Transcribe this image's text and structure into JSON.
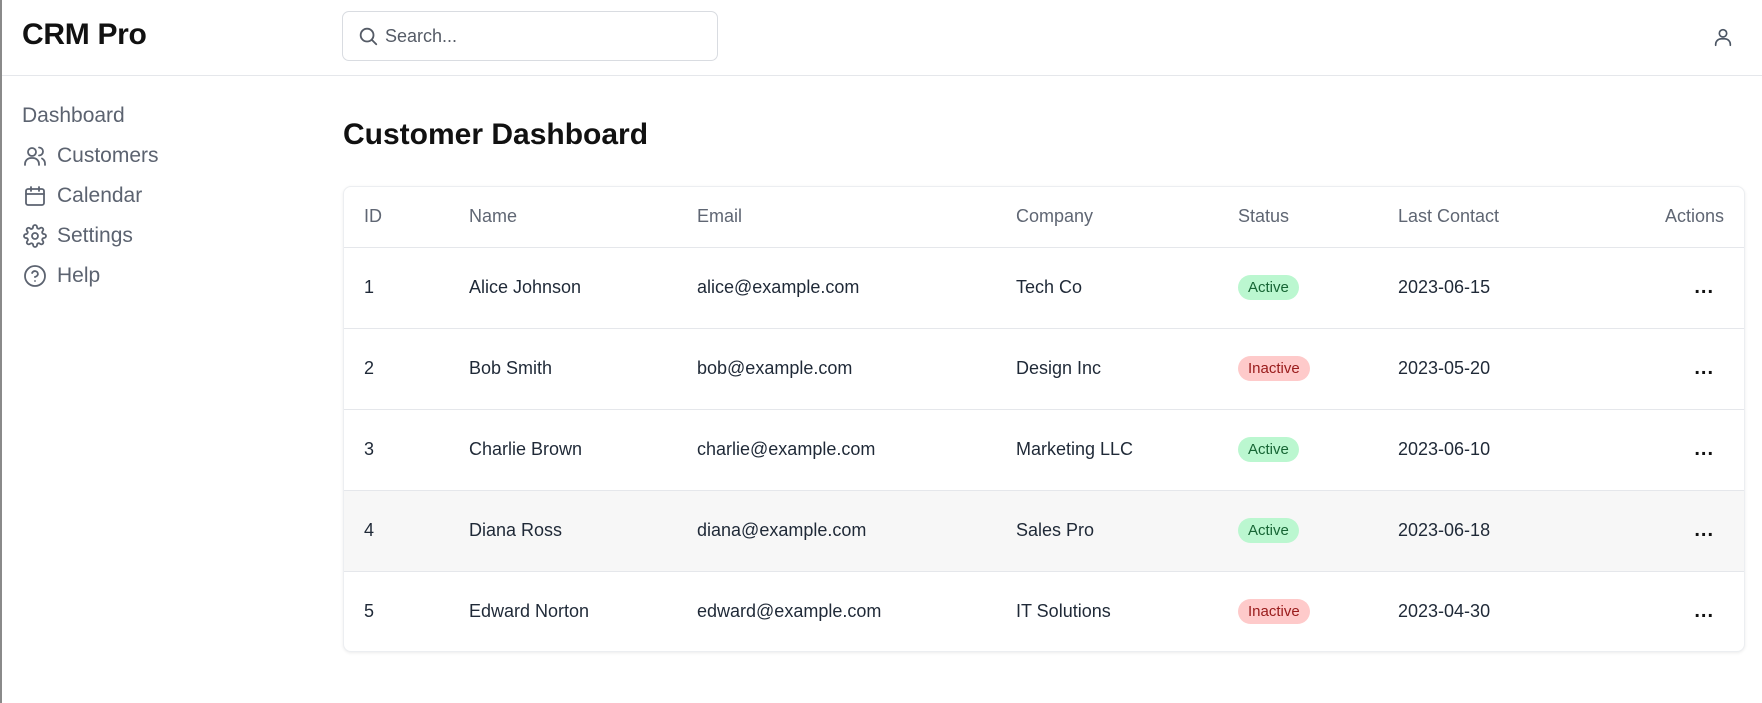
{
  "app": {
    "title": "CRM Pro"
  },
  "search": {
    "placeholder": "Search...",
    "value": ""
  },
  "sidebar": {
    "items": [
      {
        "label": "Dashboard",
        "icon": ""
      },
      {
        "label": "Customers",
        "icon": "users-icon"
      },
      {
        "label": "Calendar",
        "icon": "calendar-icon"
      },
      {
        "label": "Settings",
        "icon": "gear-icon"
      },
      {
        "label": "Help",
        "icon": "help-circle-icon"
      }
    ]
  },
  "main": {
    "title": "Customer Dashboard",
    "table": {
      "columns": [
        "ID",
        "Name",
        "Email",
        "Company",
        "Status",
        "Last Contact",
        "Actions"
      ],
      "rows": [
        {
          "id": "1",
          "name": "Alice Johnson",
          "email": "alice@example.com",
          "company": "Tech Co",
          "status": "Active",
          "last_contact": "2023-06-15",
          "actions": "..."
        },
        {
          "id": "2",
          "name": "Bob Smith",
          "email": "bob@example.com",
          "company": "Design Inc",
          "status": "Inactive",
          "last_contact": "2023-05-20",
          "actions": "..."
        },
        {
          "id": "3",
          "name": "Charlie Brown",
          "email": "charlie@example.com",
          "company": "Marketing LLC",
          "status": "Active",
          "last_contact": "2023-06-10",
          "actions": "..."
        },
        {
          "id": "4",
          "name": "Diana Ross",
          "email": "diana@example.com",
          "company": "Sales Pro",
          "status": "Active",
          "last_contact": "2023-06-18",
          "actions": "..."
        },
        {
          "id": "5",
          "name": "Edward Norton",
          "email": "edward@example.com",
          "company": "IT Solutions",
          "status": "Inactive",
          "last_contact": "2023-04-30",
          "actions": "..."
        }
      ]
    }
  },
  "colors": {
    "active_badge_bg": "#bbf7d0",
    "active_badge_text": "#166534",
    "inactive_badge_bg": "#fecaca",
    "inactive_badge_text": "#991b1b",
    "hovered_row_bg": "#f7f7f7"
  }
}
